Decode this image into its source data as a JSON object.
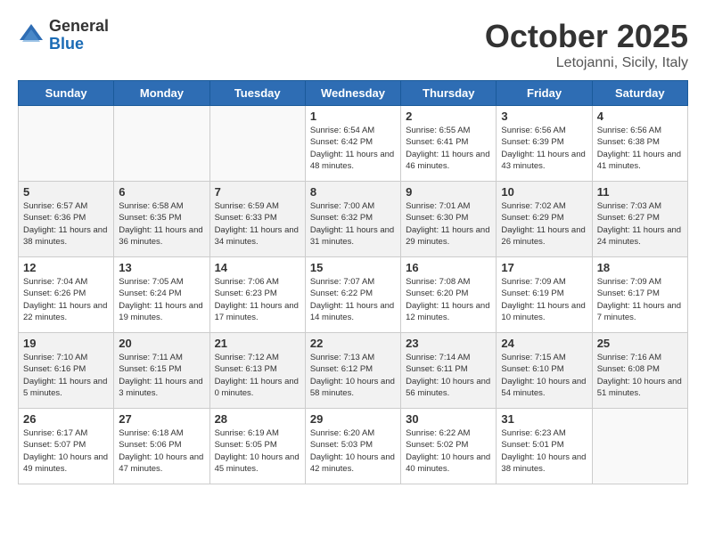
{
  "header": {
    "logo": {
      "general": "General",
      "blue": "Blue"
    },
    "month": "October 2025",
    "location": "Letojanni, Sicily, Italy"
  },
  "weekdays": [
    "Sunday",
    "Monday",
    "Tuesday",
    "Wednesday",
    "Thursday",
    "Friday",
    "Saturday"
  ],
  "weeks": [
    [
      {
        "day": null
      },
      {
        "day": null
      },
      {
        "day": null
      },
      {
        "day": 1,
        "sunrise": "6:54 AM",
        "sunset": "6:42 PM",
        "daylight": "11 hours and 48 minutes."
      },
      {
        "day": 2,
        "sunrise": "6:55 AM",
        "sunset": "6:41 PM",
        "daylight": "11 hours and 46 minutes."
      },
      {
        "day": 3,
        "sunrise": "6:56 AM",
        "sunset": "6:39 PM",
        "daylight": "11 hours and 43 minutes."
      },
      {
        "day": 4,
        "sunrise": "6:56 AM",
        "sunset": "6:38 PM",
        "daylight": "11 hours and 41 minutes."
      }
    ],
    [
      {
        "day": 5,
        "sunrise": "6:57 AM",
        "sunset": "6:36 PM",
        "daylight": "11 hours and 38 minutes."
      },
      {
        "day": 6,
        "sunrise": "6:58 AM",
        "sunset": "6:35 PM",
        "daylight": "11 hours and 36 minutes."
      },
      {
        "day": 7,
        "sunrise": "6:59 AM",
        "sunset": "6:33 PM",
        "daylight": "11 hours and 34 minutes."
      },
      {
        "day": 8,
        "sunrise": "7:00 AM",
        "sunset": "6:32 PM",
        "daylight": "11 hours and 31 minutes."
      },
      {
        "day": 9,
        "sunrise": "7:01 AM",
        "sunset": "6:30 PM",
        "daylight": "11 hours and 29 minutes."
      },
      {
        "day": 10,
        "sunrise": "7:02 AM",
        "sunset": "6:29 PM",
        "daylight": "11 hours and 26 minutes."
      },
      {
        "day": 11,
        "sunrise": "7:03 AM",
        "sunset": "6:27 PM",
        "daylight": "11 hours and 24 minutes."
      }
    ],
    [
      {
        "day": 12,
        "sunrise": "7:04 AM",
        "sunset": "6:26 PM",
        "daylight": "11 hours and 22 minutes."
      },
      {
        "day": 13,
        "sunrise": "7:05 AM",
        "sunset": "6:24 PM",
        "daylight": "11 hours and 19 minutes."
      },
      {
        "day": 14,
        "sunrise": "7:06 AM",
        "sunset": "6:23 PM",
        "daylight": "11 hours and 17 minutes."
      },
      {
        "day": 15,
        "sunrise": "7:07 AM",
        "sunset": "6:22 PM",
        "daylight": "11 hours and 14 minutes."
      },
      {
        "day": 16,
        "sunrise": "7:08 AM",
        "sunset": "6:20 PM",
        "daylight": "11 hours and 12 minutes."
      },
      {
        "day": 17,
        "sunrise": "7:09 AM",
        "sunset": "6:19 PM",
        "daylight": "11 hours and 10 minutes."
      },
      {
        "day": 18,
        "sunrise": "7:09 AM",
        "sunset": "6:17 PM",
        "daylight": "11 hours and 7 minutes."
      }
    ],
    [
      {
        "day": 19,
        "sunrise": "7:10 AM",
        "sunset": "6:16 PM",
        "daylight": "11 hours and 5 minutes."
      },
      {
        "day": 20,
        "sunrise": "7:11 AM",
        "sunset": "6:15 PM",
        "daylight": "11 hours and 3 minutes."
      },
      {
        "day": 21,
        "sunrise": "7:12 AM",
        "sunset": "6:13 PM",
        "daylight": "11 hours and 0 minutes."
      },
      {
        "day": 22,
        "sunrise": "7:13 AM",
        "sunset": "6:12 PM",
        "daylight": "10 hours and 58 minutes."
      },
      {
        "day": 23,
        "sunrise": "7:14 AM",
        "sunset": "6:11 PM",
        "daylight": "10 hours and 56 minutes."
      },
      {
        "day": 24,
        "sunrise": "7:15 AM",
        "sunset": "6:10 PM",
        "daylight": "10 hours and 54 minutes."
      },
      {
        "day": 25,
        "sunrise": "7:16 AM",
        "sunset": "6:08 PM",
        "daylight": "10 hours and 51 minutes."
      }
    ],
    [
      {
        "day": 26,
        "sunrise": "6:17 AM",
        "sunset": "5:07 PM",
        "daylight": "10 hours and 49 minutes."
      },
      {
        "day": 27,
        "sunrise": "6:18 AM",
        "sunset": "5:06 PM",
        "daylight": "10 hours and 47 minutes."
      },
      {
        "day": 28,
        "sunrise": "6:19 AM",
        "sunset": "5:05 PM",
        "daylight": "10 hours and 45 minutes."
      },
      {
        "day": 29,
        "sunrise": "6:20 AM",
        "sunset": "5:03 PM",
        "daylight": "10 hours and 42 minutes."
      },
      {
        "day": 30,
        "sunrise": "6:22 AM",
        "sunset": "5:02 PM",
        "daylight": "10 hours and 40 minutes."
      },
      {
        "day": 31,
        "sunrise": "6:23 AM",
        "sunset": "5:01 PM",
        "daylight": "10 hours and 38 minutes."
      },
      {
        "day": null
      }
    ]
  ]
}
